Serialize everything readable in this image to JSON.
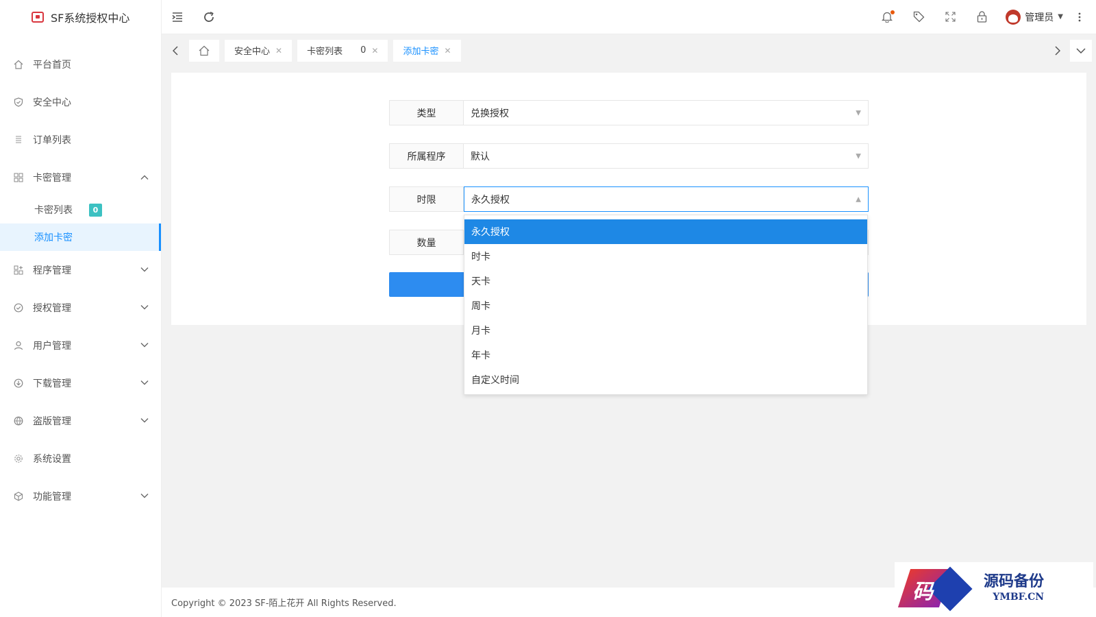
{
  "app": {
    "title": "SF系统授权中心"
  },
  "sidebar": {
    "items": [
      {
        "label": "平台首页",
        "icon": "home-icon"
      },
      {
        "label": "安全中心",
        "icon": "shield-icon"
      },
      {
        "label": "订单列表",
        "icon": "list-icon"
      },
      {
        "label": "卡密管理",
        "icon": "grid-icon",
        "expanded": true
      },
      {
        "label": "程序管理",
        "icon": "apps-icon"
      },
      {
        "label": "授权管理",
        "icon": "check-circle-icon"
      },
      {
        "label": "用户管理",
        "icon": "user-icon"
      },
      {
        "label": "下载管理",
        "icon": "download-icon"
      },
      {
        "label": "盗版管理",
        "icon": "globe-icon"
      },
      {
        "label": "系统设置",
        "icon": "gear-icon"
      },
      {
        "label": "功能管理",
        "icon": "cube-icon"
      }
    ],
    "submenu": [
      {
        "label": "卡密列表",
        "badge": "0"
      },
      {
        "label": "添加卡密",
        "active": true
      }
    ]
  },
  "header": {
    "user": "管理员"
  },
  "tabs": [
    {
      "label": "安全中心"
    },
    {
      "label": "卡密列表",
      "count": "0"
    },
    {
      "label": "添加卡密",
      "active": true
    }
  ],
  "form": {
    "type_label": "类型",
    "type_value": "兑换授权",
    "program_label": "所属程序",
    "program_value": "默认",
    "duration_label": "时限",
    "duration_value": "永久授权",
    "quantity_label": "数量"
  },
  "dropdown": {
    "options": [
      "永久授权",
      "时卡",
      "天卡",
      "周卡",
      "月卡",
      "年卡",
      "自定义时间"
    ],
    "selected": "永久授权"
  },
  "footer": {
    "text": "Copyright © 2023 SF-陌上花开 All Rights Reserved."
  },
  "watermark": {
    "cn": "源码备份",
    "en": "YMBF.CN",
    "glyph": "码"
  },
  "colors": {
    "accent": "#1890ff",
    "dropdown_selected": "#1e88e5",
    "badge": "#3cc1c2",
    "submit": "#2d8cf0"
  }
}
